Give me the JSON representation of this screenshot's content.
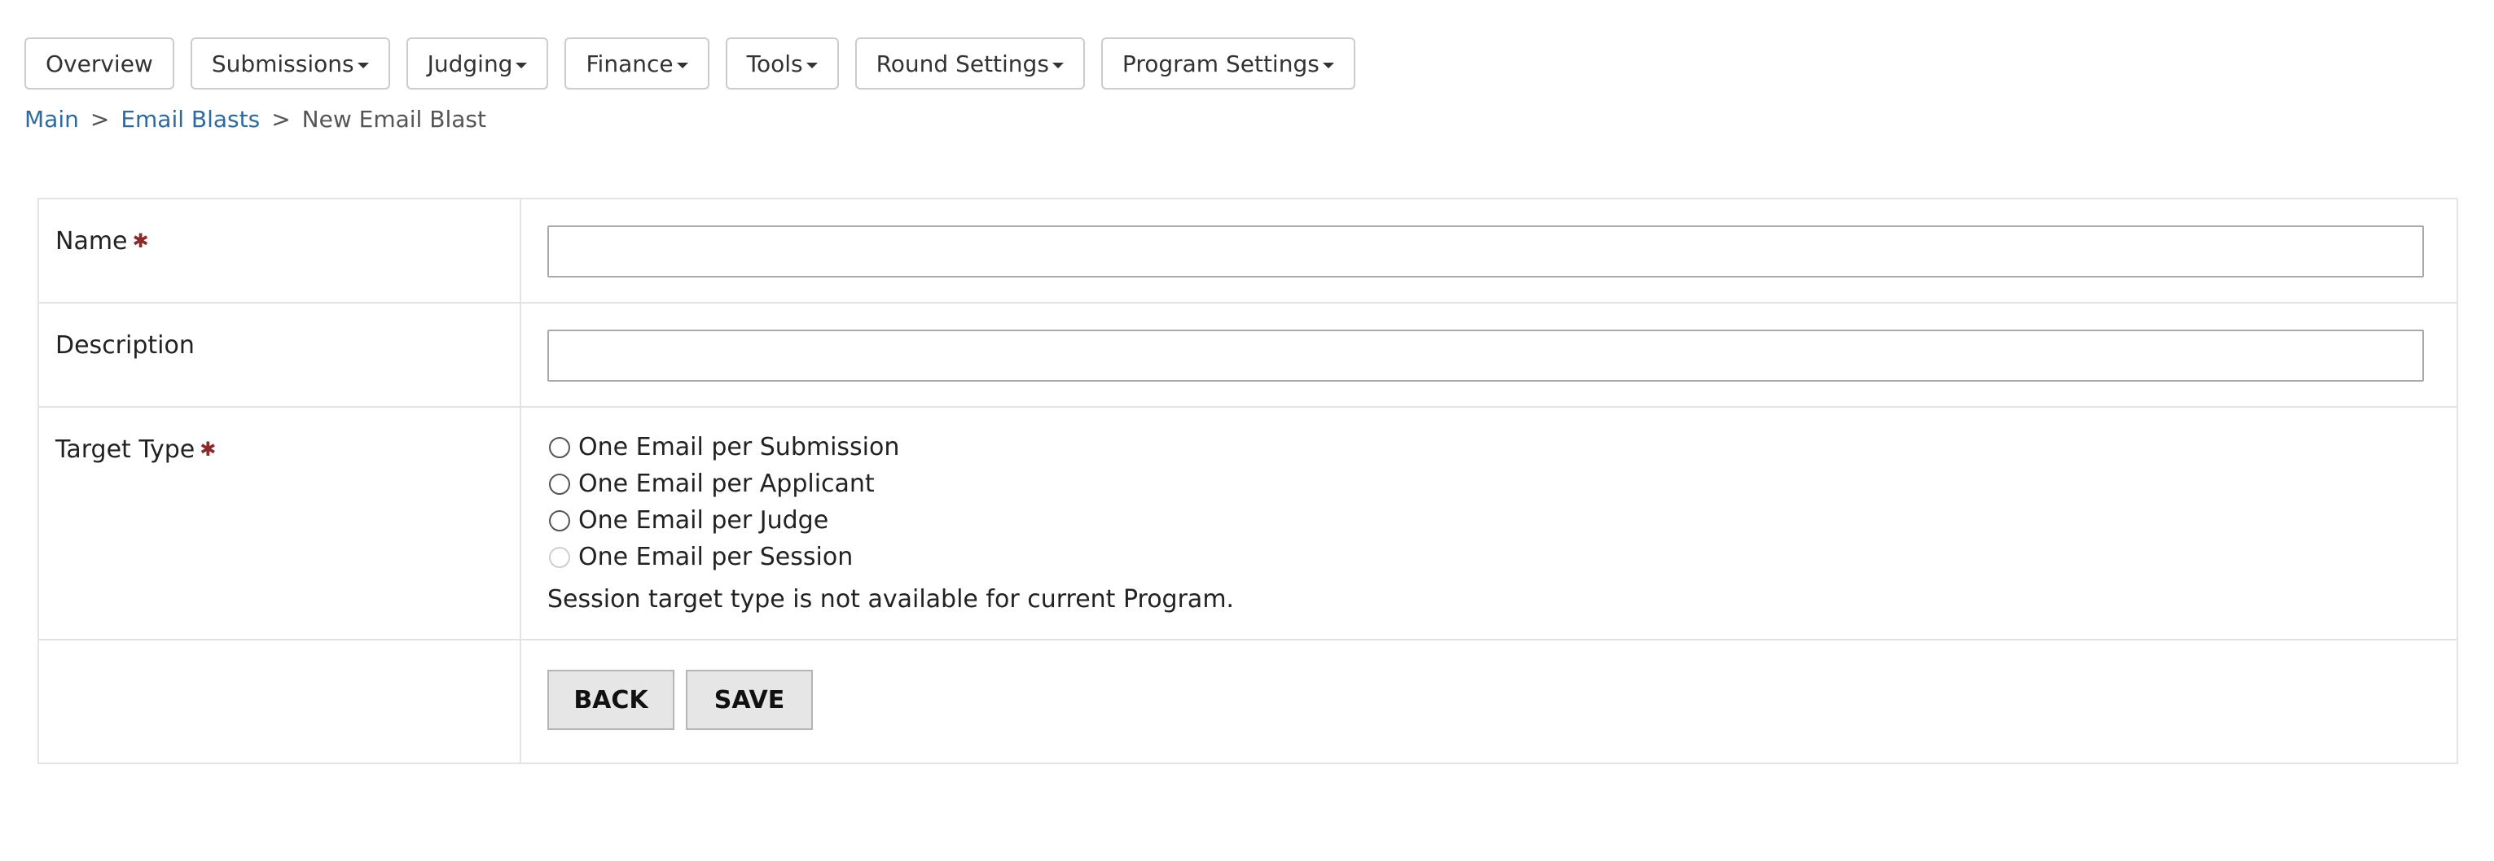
{
  "nav": {
    "items": [
      {
        "label": "Overview",
        "dropdown": false
      },
      {
        "label": "Submissions",
        "dropdown": true
      },
      {
        "label": "Judging",
        "dropdown": true
      },
      {
        "label": "Finance",
        "dropdown": true
      },
      {
        "label": "Tools",
        "dropdown": true
      },
      {
        "label": "Round Settings",
        "dropdown": true
      },
      {
        "label": "Program Settings",
        "dropdown": true
      }
    ]
  },
  "breadcrumb": {
    "main": "Main",
    "email_blasts": "Email Blasts",
    "current": "New Email Blast",
    "separator": ">"
  },
  "form": {
    "name": {
      "label": "Name",
      "required": true,
      "value": "",
      "placeholder": ""
    },
    "description": {
      "label": "Description",
      "required": false,
      "value": "",
      "placeholder": ""
    },
    "target_type": {
      "label": "Target Type",
      "required": true,
      "options": [
        {
          "label": "One Email per Submission",
          "selected": false,
          "disabled": false
        },
        {
          "label": "One Email per Applicant",
          "selected": false,
          "disabled": false
        },
        {
          "label": "One Email per Judge",
          "selected": false,
          "disabled": false
        },
        {
          "label": "One Email per Session",
          "selected": false,
          "disabled": true
        }
      ],
      "note": "Session target type is not available for current Program."
    },
    "actions": {
      "back_label": "BACK",
      "save_label": "SAVE"
    }
  },
  "colors": {
    "link": "#2d6a9f",
    "required_marker": "#8b2a2a",
    "border": "#e3e3e3",
    "button_bg": "#e6e6e6"
  },
  "icons": {
    "required": "asterisk-icon",
    "dropdown": "caret-down-icon"
  }
}
